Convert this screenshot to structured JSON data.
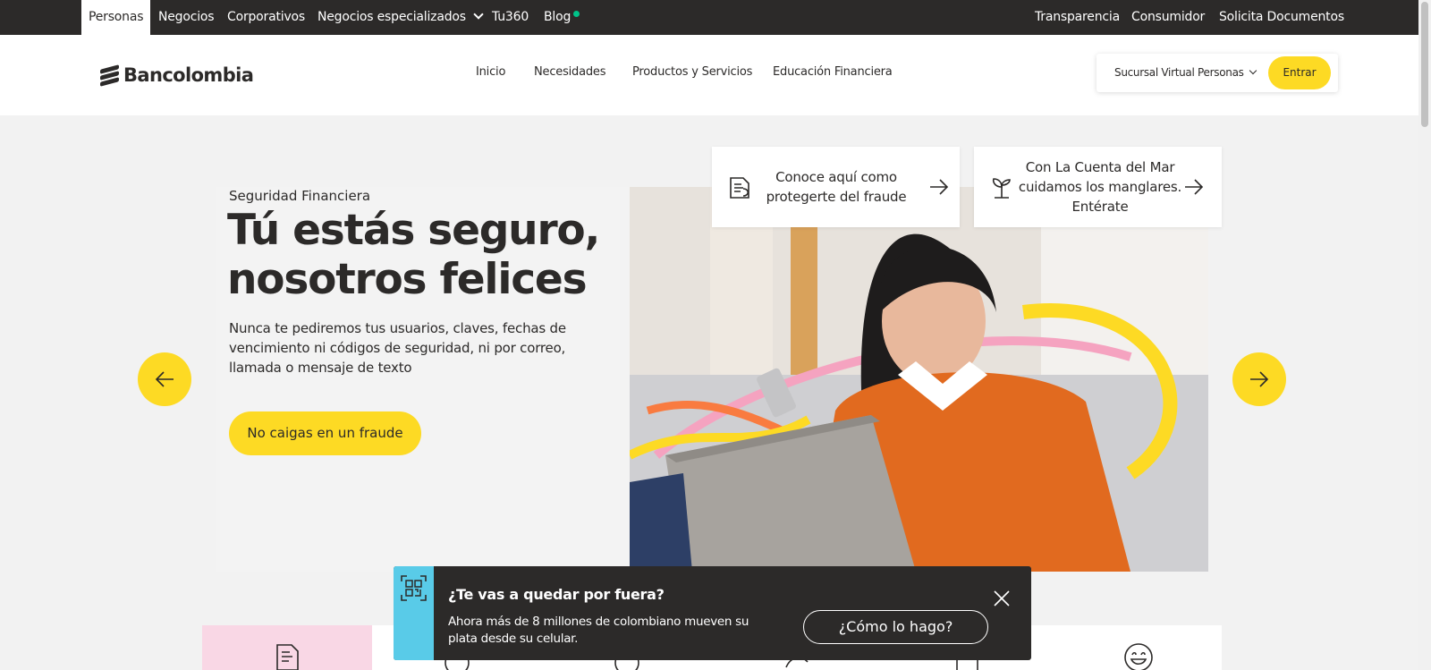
{
  "topbar": {
    "segments": [
      {
        "label": "Personas"
      },
      {
        "label": "Negocios"
      },
      {
        "label": "Corporativos"
      },
      {
        "label": "Negocios especializados"
      },
      {
        "label": "Tu360"
      },
      {
        "label": "Blog"
      }
    ],
    "right_links": [
      {
        "label": "Transparencia"
      },
      {
        "label": "Consumidor"
      },
      {
        "label": "Solicita Documentos"
      }
    ]
  },
  "header": {
    "logo_text": "Bancolombia",
    "nav": [
      {
        "label": "Inicio"
      },
      {
        "label": "Necesidades"
      },
      {
        "label": "Productos y Servicios"
      },
      {
        "label": "Educación Financiera"
      }
    ],
    "sucursal_label": "Sucursal Virtual Personas",
    "login_label": "Entrar"
  },
  "hero": {
    "eyebrow": "Seguridad Financiera",
    "title": "Tú estás seguro, nosotros felices",
    "description": "Nunca te pediremos tus usuarios, claves, fechas de vencimiento ni códigos de seguridad, ni por correo, llamada o mensaje de texto",
    "cta_label": "No caigas en un fraude"
  },
  "promos": [
    {
      "text": "Conoce aquí como protegerte del fraude",
      "icon": "document-icon"
    },
    {
      "text": "Con La Cuenta del Mar cuidamos los manglares. Entérate",
      "icon": "plant-icon"
    }
  ],
  "banner": {
    "title": "¿Te vas a quedar por fuera?",
    "text": "Ahora más de 8 millones de colombiano mueven su plata desde su celular.",
    "button_label": "¿Cómo lo hago?"
  },
  "colors": {
    "brand_yellow": "#fdda24",
    "dark": "#2c2a29",
    "banner_accent": "#59cbe8",
    "pink": "#f9d7e5"
  }
}
